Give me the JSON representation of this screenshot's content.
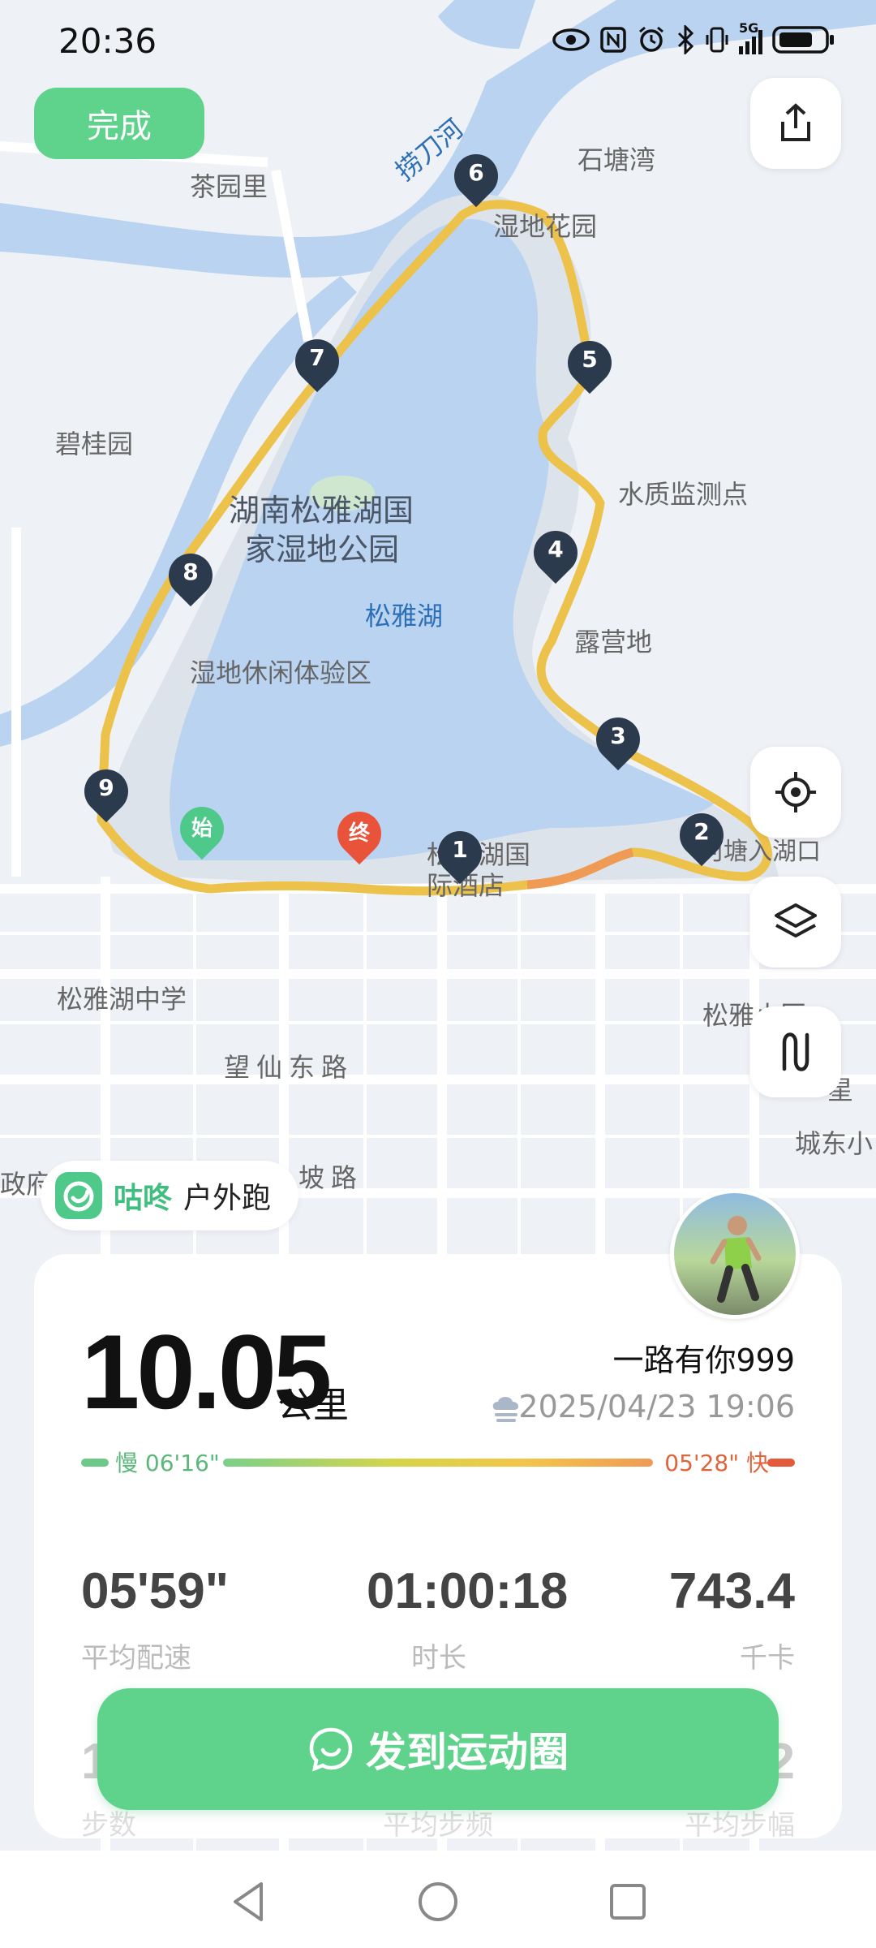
{
  "status_bar": {
    "time": "20:36",
    "icons": [
      "eye-icon",
      "nfc-icon",
      "alarm-icon",
      "bluetooth-icon",
      "vibrate-icon",
      "signal-5g-icon",
      "battery-icon"
    ],
    "network_label": "5G"
  },
  "toolbar": {
    "done_label": "完成"
  },
  "map": {
    "places": {
      "chayuanli": "茶园里",
      "laodaohe": "捞刀河",
      "shitangwan": "石塘湾",
      "shidihuayuan": "湿地花园",
      "biguiyuan": "碧桂园",
      "park_line1": "湖南松雅湖国",
      "park_line2": "家湿地公园",
      "shuizhi": "水质监测点",
      "lake": "松雅湖",
      "luying": "露营地",
      "xiuxian": "湿地休闲体验区",
      "hekou": "河塘入湖口",
      "intl": "松雅湖国",
      "intl2": "际酒店",
      "school": "松雅湖中学",
      "wangxian": "望仙东路",
      "qiaopo": "坡路",
      "songyaxiaoqu": "松雅小区",
      "chengdong": "城东小",
      "xing": "星",
      "zhengfu": "政府"
    },
    "markers": [
      "1",
      "2",
      "3",
      "4",
      "5",
      "6",
      "7",
      "8",
      "9"
    ],
    "start_label": "始",
    "end_label": "终"
  },
  "brand": {
    "name": "咕咚",
    "activity": "户外跑"
  },
  "summary": {
    "distance": "10.05",
    "distance_unit": "公里",
    "username": "一路有你999",
    "datetime": "2025/04/23 19:06",
    "pace_slow": "慢 06'16\"",
    "pace_fast": "05'28\" 快",
    "stats": [
      {
        "value": "05'59\"",
        "label": "平均配速"
      },
      {
        "value": "01:00:18",
        "label": "时长"
      },
      {
        "value": "743.4",
        "label": "千卡"
      }
    ],
    "row2": [
      {
        "value": "1",
        "label": "步数"
      },
      {
        "value": "",
        "label": "平均步频"
      },
      {
        "value": "2",
        "label": "平均步幅"
      }
    ]
  },
  "post_button": {
    "label": "发到运动圈"
  },
  "colors": {
    "accent": "#5fd28c",
    "route": "#ecc24a",
    "water": "#b9d3f0",
    "marker": "#2c3a4d",
    "end": "#e8533a"
  }
}
